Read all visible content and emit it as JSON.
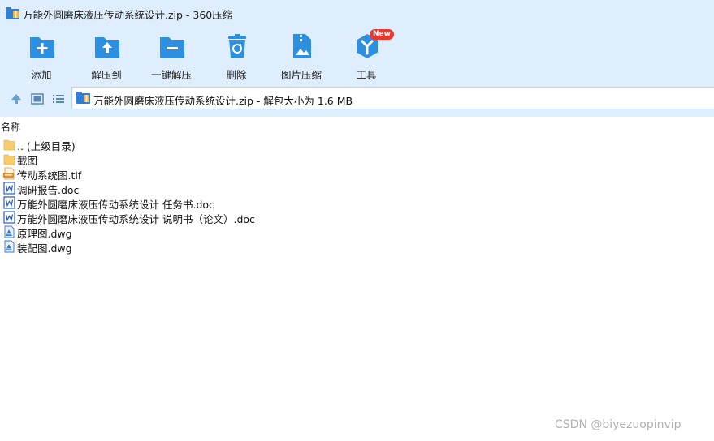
{
  "window": {
    "title": "万能外圆磨床液压传动系统设计.zip - 360压缩"
  },
  "toolbar": {
    "items": [
      {
        "label": "添加",
        "icon": "add-folder-icon"
      },
      {
        "label": "解压到",
        "icon": "extract-to-folder-icon"
      },
      {
        "label": "一键解压",
        "icon": "one-click-extract-icon"
      },
      {
        "label": "删除",
        "icon": "recycle-bin-icon"
      },
      {
        "label": "图片压缩",
        "icon": "image-compress-icon"
      },
      {
        "label": "工具",
        "icon": "tools-icon",
        "badge": "New"
      }
    ]
  },
  "navbar": {
    "path": "万能外圆磨床液压传动系统设计.zip - 解包大小为 1.6 MB"
  },
  "filelist": {
    "header": "名称",
    "items": [
      {
        "name": ".. (上级目录)",
        "type": "folder"
      },
      {
        "name": "截图",
        "type": "folder"
      },
      {
        "name": "传动系统图.tif",
        "type": "tif"
      },
      {
        "name": "调研报告.doc",
        "type": "doc"
      },
      {
        "name": "万能外圆磨床液压传动系统设计 任务书.doc",
        "type": "doc"
      },
      {
        "name": "万能外圆磨床液压传动系统设计 说明书（论文）.doc",
        "type": "doc"
      },
      {
        "name": "原理图.dwg",
        "type": "dwg"
      },
      {
        "name": "装配图.dwg",
        "type": "dwg"
      }
    ]
  },
  "watermark": "CSDN @biyezuopinvip",
  "colors": {
    "chrome_bg": "#dfeefc",
    "icon_blue": "#2d8fe0",
    "badge_red": "#e8372f"
  }
}
